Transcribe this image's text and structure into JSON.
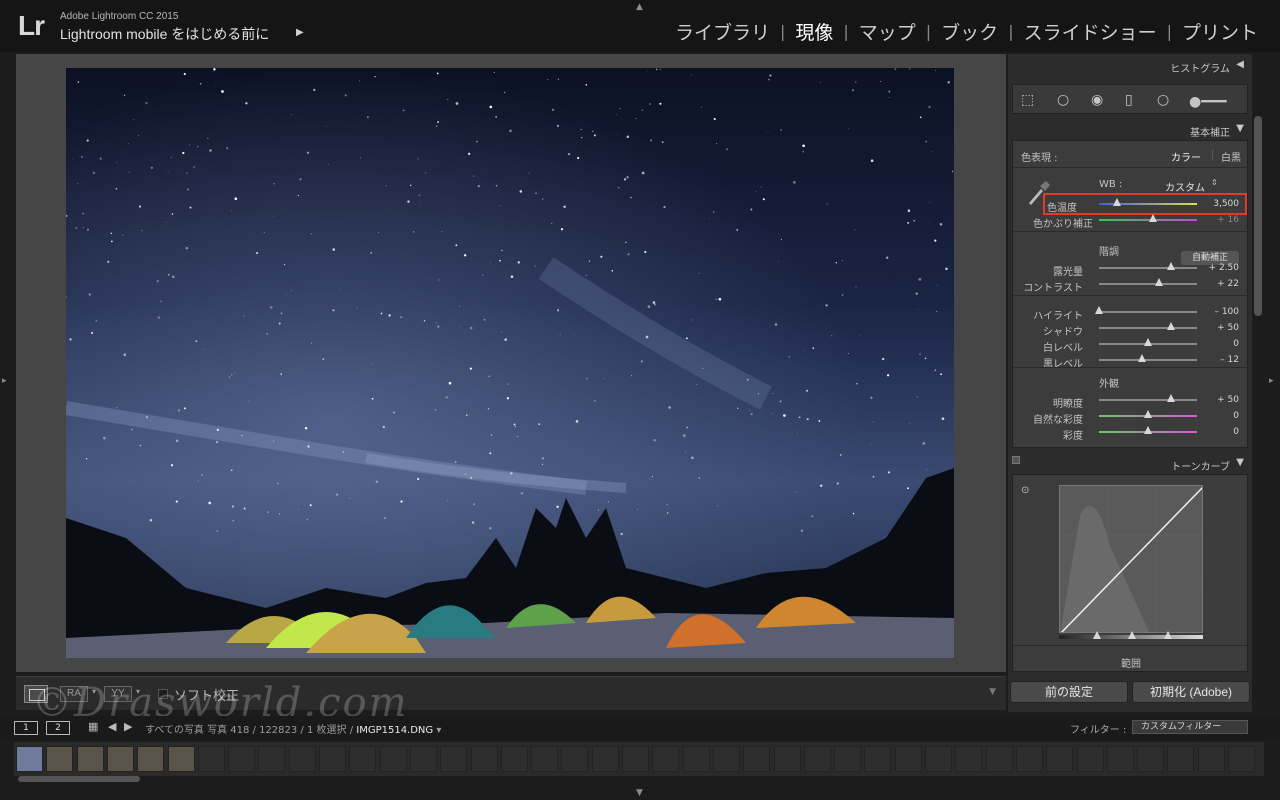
{
  "titlebar": {
    "logo": "Lr",
    "app_name": "Adobe Lightroom CC 2015",
    "id_plate": "Lightroom mobile をはじめる前に",
    "modules": [
      "ライブラリ",
      "現像",
      "マップ",
      "ブック",
      "スライドショー",
      "プリント"
    ],
    "active_module": "現像"
  },
  "toolbar": {
    "before_after_ra": "RA",
    "before_after_yy": "YY",
    "soft_proof_label": "ソフト校正"
  },
  "panels": {
    "histogram": {
      "label": "ヒストグラム"
    },
    "basic": {
      "label": "基本補正",
      "treatment_label": "色表現 :",
      "treatment_color": "カラー",
      "treatment_bw": "白黒",
      "wb_label": "WB :",
      "wb_value": "カスタム",
      "temp_label": "色温度",
      "temp_value": "3,500",
      "temp_pos": 0.18,
      "tint_label": "色かぶり補正",
      "tint_value": "+ 16",
      "tint_pos": 0.55,
      "tone_section": "階調",
      "auto_button": "自動補正",
      "sliders_tone": [
        {
          "label": "露光量",
          "value": "+ 2.50",
          "pos": 0.73
        },
        {
          "label": "コントラスト",
          "value": "+ 22",
          "pos": 0.61
        }
      ],
      "sliders_light": [
        {
          "label": "ハイライト",
          "value": "– 100",
          "pos": 0.0
        },
        {
          "label": "シャドウ",
          "value": "+ 50",
          "pos": 0.73
        },
        {
          "label": "白レベル",
          "value": "0",
          "pos": 0.5
        },
        {
          "label": "黒レベル",
          "value": "– 12",
          "pos": 0.44
        }
      ],
      "presence_section": "外観",
      "sliders_presence": [
        {
          "label": "明瞭度",
          "value": "+ 50",
          "pos": 0.73
        },
        {
          "label": "自然な彩度",
          "value": "0",
          "pos": 0.5
        },
        {
          "label": "彩度",
          "value": "0",
          "pos": 0.5
        }
      ]
    },
    "tone_curve": {
      "label": "トーンカーブ",
      "range_label": "範囲"
    },
    "prev_button": "前の設定",
    "reset_button": "初期化 (Adobe)"
  },
  "filmstrip": {
    "screen1": "1",
    "screen2": "2",
    "info_prefix": "すべての写真   写真 418 / 122823 / 1 枚選択 /",
    "filename": "IMGP1514.DNG",
    "filter_label": "フィルター :",
    "filter_value": "カスタムフィルター"
  },
  "watermark": "©Drasworld.com"
}
